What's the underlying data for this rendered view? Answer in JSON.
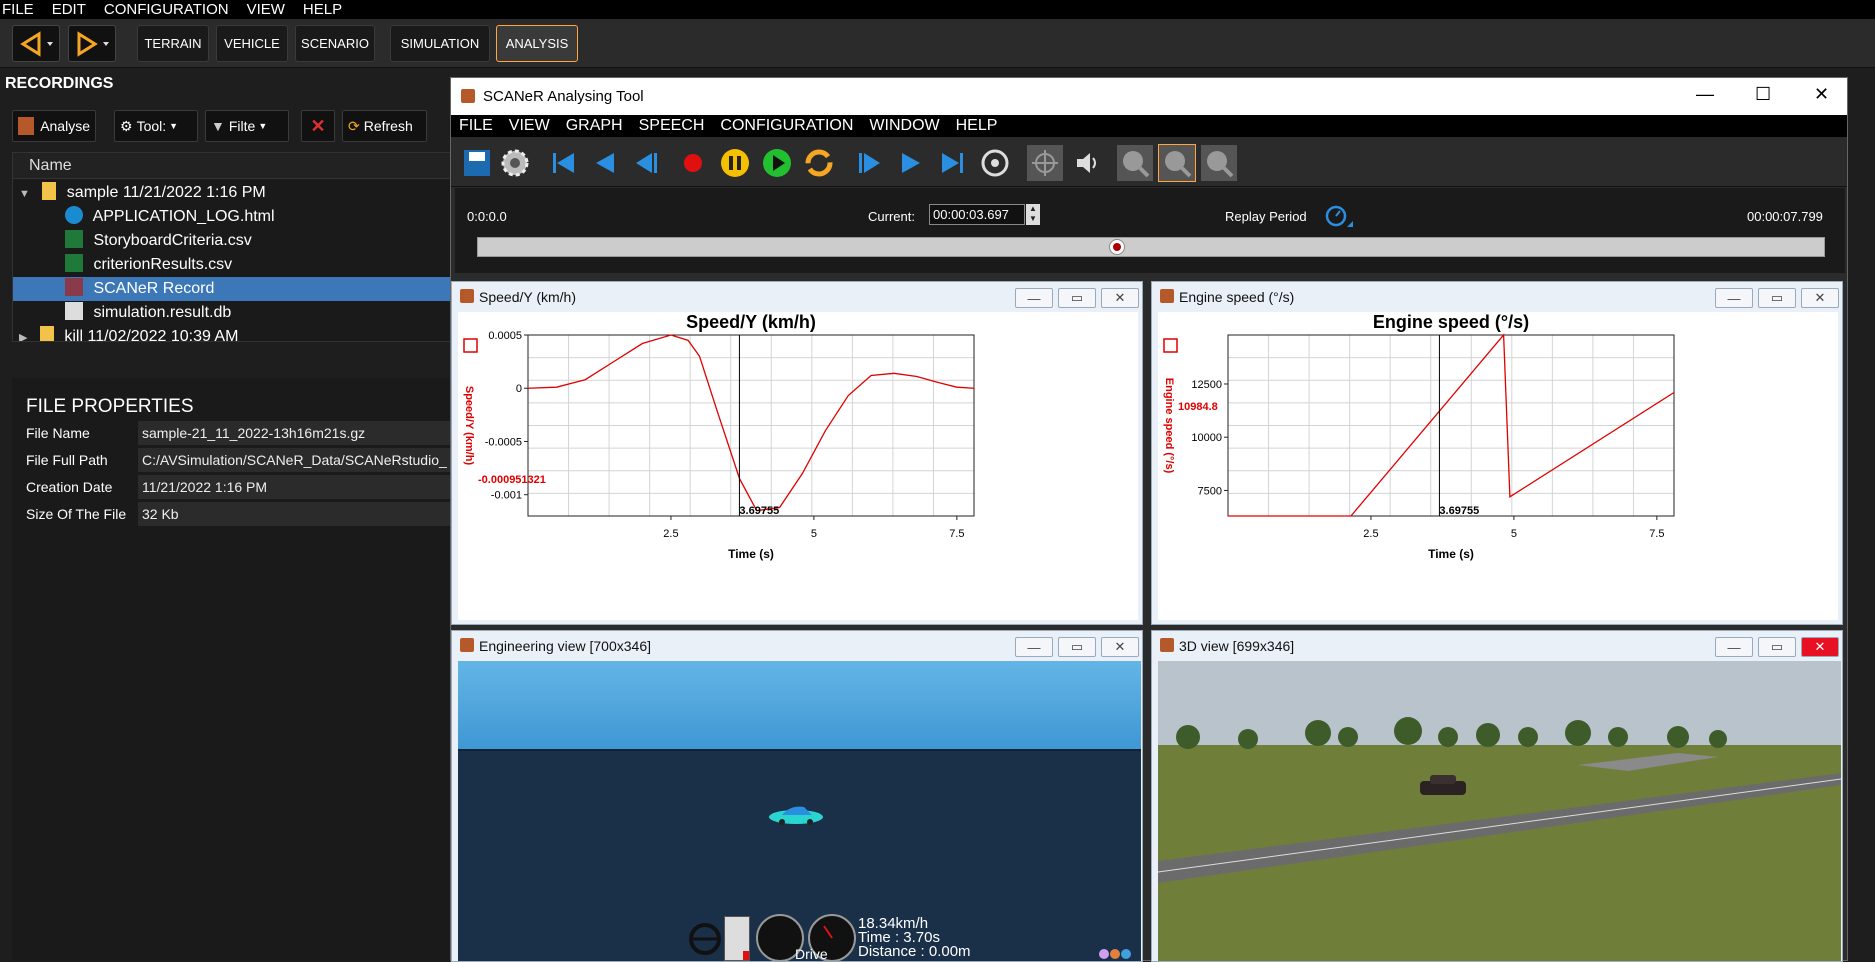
{
  "app": {
    "menu": [
      "FILE",
      "EDIT",
      "CONFIGURATION",
      "VIEW",
      "HELP"
    ],
    "modes": [
      "TERRAIN",
      "VEHICLE",
      "SCENARIO",
      "SIMULATION",
      "ANALYSIS"
    ],
    "active_mode": "ANALYSIS"
  },
  "recordings": {
    "title": "RECORDINGS",
    "buttons": {
      "analyse": "Analyse",
      "tools": "Tool:",
      "filter": "Filte",
      "refresh": "Refresh"
    },
    "column": "Name",
    "items": [
      {
        "label": "sample 11/21/2022 1:16 PM"
      },
      {
        "label": "APPLICATION_LOG.html"
      },
      {
        "label": "StoryboardCriteria.csv"
      },
      {
        "label": "criterionResults.csv"
      },
      {
        "label": "SCANeR Record"
      },
      {
        "label": "simulation.result.db"
      },
      {
        "label": "kill 11/02/2022 10:39 AM"
      }
    ]
  },
  "file_properties": {
    "title": "FILE PROPERTIES",
    "rows": [
      {
        "key": "File Name",
        "value": "sample-21_11_2022-13h16m21s.gz"
      },
      {
        "key": "File Full Path",
        "value": "C:/AVSimulation/SCANeR_Data/SCANeRstudio_"
      },
      {
        "key": "Creation Date",
        "value": "11/21/2022 1:16 PM"
      },
      {
        "key": "Size Of The File",
        "value": "32 Kb"
      }
    ]
  },
  "tool": {
    "title": "SCANeR Analysing Tool",
    "menu": [
      "FILE",
      "VIEW",
      "GRAPH",
      "SPEECH",
      "CONFIGURATION",
      "WINDOW",
      "HELP"
    ],
    "timeline": {
      "start": "0:0:0.0",
      "current_label": "Current:",
      "current": "00:00:03.697",
      "replay_label": "Replay Period",
      "end": "00:00:07.799",
      "position": 0.474
    }
  },
  "panes": {
    "speed": {
      "title": "Speed/Y (km/h)"
    },
    "engine": {
      "title": "Engine speed (°/s)"
    },
    "eng_view": {
      "title": "Engineering view [700x346]",
      "hud_speed": "18.34km/h",
      "hud_time": "Time : 3.70s",
      "hud_distance": "Distance : 0.00m",
      "hud_gear": "Drive"
    },
    "view3d": {
      "title": "3D view [699x346]"
    }
  },
  "chart_data": [
    {
      "type": "line",
      "title": "Speed/Y (km/h)",
      "xlabel": "Time (s)",
      "ylabel": "Speed/Y (km/h)",
      "xlim": [
        0,
        7.8
      ],
      "ylim": [
        -0.0012,
        0.0005
      ],
      "xticks": [
        2.5,
        5,
        7.5
      ],
      "yticks": [
        0.0005,
        0,
        -0.0005,
        -0.001
      ],
      "ytick_labels": [
        "0.0005",
        "0",
        "-0.0005",
        "-0.001"
      ],
      "cursor_x": 3.69755,
      "cursor_label": "3.69755",
      "cursor_value": "-0.000951321",
      "series": [
        {
          "color": "#e00000",
          "x": [
            0,
            0.5,
            1.0,
            1.5,
            2.0,
            2.5,
            2.8,
            3.0,
            3.3,
            3.7,
            4.0,
            4.4,
            4.8,
            5.2,
            5.6,
            6.0,
            6.4,
            6.8,
            7.2,
            7.5,
            7.8
          ],
          "y": [
            0,
            1e-05,
            8e-05,
            0.00025,
            0.00042,
            0.0005,
            0.00045,
            0.0003,
            -0.0002,
            -0.00085,
            -0.00115,
            -0.00112,
            -0.0008,
            -0.0004,
            -7e-05,
            0.00012,
            0.00014,
            0.00011,
            5e-05,
            1e-05,
            0
          ]
        }
      ],
      "grid": true
    },
    {
      "type": "line",
      "title": "Engine speed (°/s)",
      "xlabel": "Time (s)",
      "ylabel": "Engine speed (°/s)",
      "xlim": [
        0,
        7.8
      ],
      "ylim": [
        6300,
        14800
      ],
      "xticks": [
        2.5,
        5,
        7.5
      ],
      "yticks": [
        12500,
        10000,
        7500
      ],
      "ytick_labels": [
        "12500",
        "10000",
        "7500"
      ],
      "cursor_x": 3.69755,
      "cursor_label": "3.69755",
      "cursor_value": "10984.8",
      "series": [
        {
          "color": "#e00000",
          "x": [
            0,
            2.15,
            4.82,
            4.82,
            4.93,
            7.8
          ],
          "y": [
            6300,
            6300,
            14800,
            14800,
            7200,
            12100
          ]
        }
      ],
      "grid": true
    }
  ]
}
